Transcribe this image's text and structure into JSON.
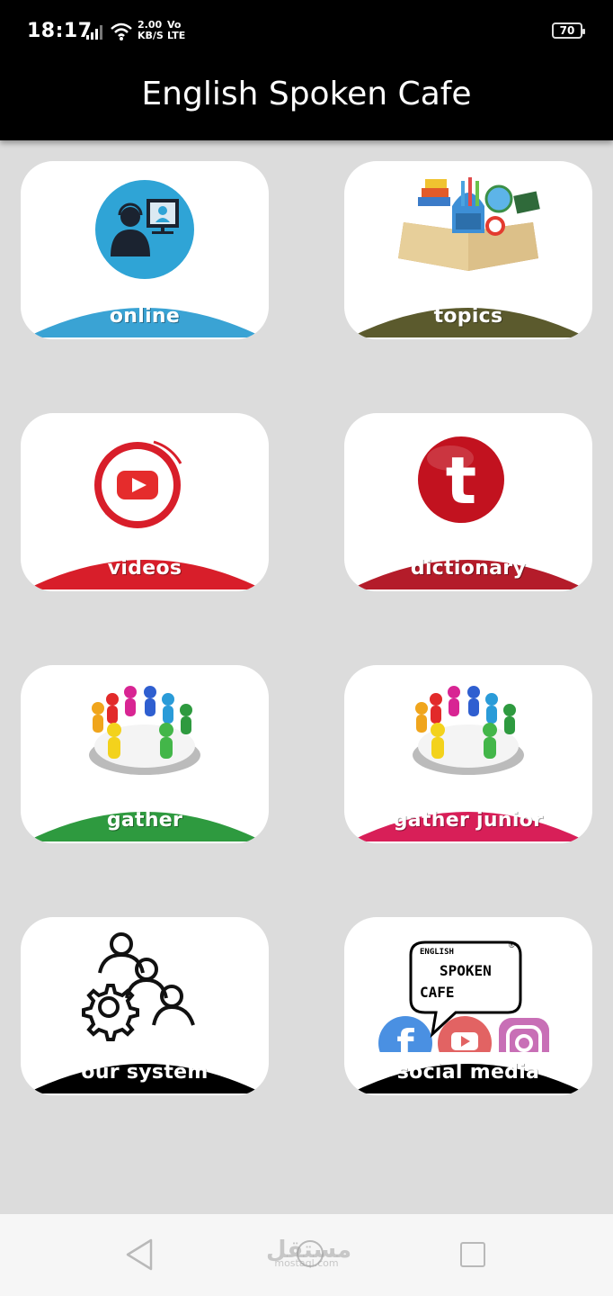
{
  "status_bar": {
    "time": "18:17",
    "speed_value": "2.00",
    "speed_unit": "KB/S",
    "volte_top": "Vo",
    "volte_bottom": "LTE",
    "battery": "70"
  },
  "app": {
    "title": "English Spoken Cafe"
  },
  "cards": [
    {
      "label": "online",
      "color": "#3aa3d4",
      "icon": "online-teacher-icon"
    },
    {
      "label": "topics",
      "color": "#5b5a2d",
      "icon": "books-topics-icon"
    },
    {
      "label": "videos",
      "color": "#d81e2a",
      "icon": "youtube-play-icon"
    },
    {
      "label": "dictionary",
      "color": "#b41c2a",
      "icon": "dictionary-t-icon"
    },
    {
      "label": "gather",
      "color": "#2e9a3f",
      "icon": "people-roundtable-icon"
    },
    {
      "label": "gather junior",
      "color": "#d81f58",
      "icon": "people-roundtable-icon"
    },
    {
      "label": "our system",
      "color": "#000000",
      "icon": "gear-people-icon"
    },
    {
      "label": "social media",
      "color": "#000000",
      "icon": "social-media-icon"
    }
  ],
  "social_logo": {
    "line1": "ENGLISH",
    "line2": "SPOKEN",
    "line3": "CAFE",
    "mark": "®"
  },
  "nav": {
    "back_icon": "back-triangle-icon",
    "home_icon": "home-circle-icon",
    "recent_icon": "recent-square-icon"
  },
  "watermark": {
    "text": "مستقل",
    "sub": "mostaql.com"
  }
}
